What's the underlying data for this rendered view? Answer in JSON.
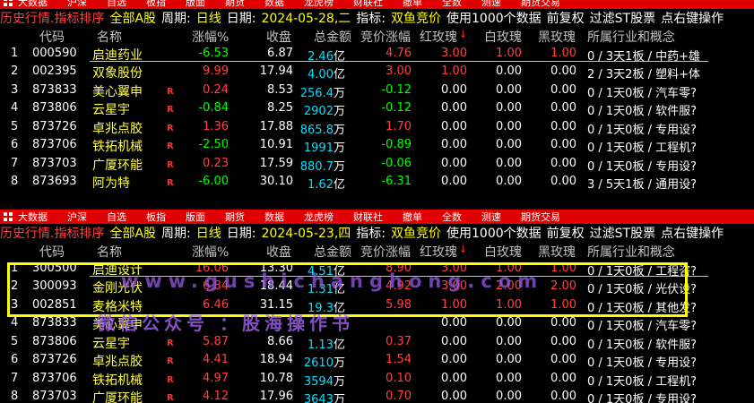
{
  "menu": [
    "大数据",
    "沪深",
    "自选",
    "板指",
    "版面",
    "期货",
    "数据",
    "龙虎榜",
    "财联社",
    "撤单",
    "全数",
    "测速",
    "期货交易"
  ],
  "colors": {
    "menu_bg": "#e00000",
    "up": "#ff4040",
    "down": "#00ff00",
    "highlight": "#ffff00"
  },
  "headers": [
    "代码",
    "名称",
    "涨幅%",
    "收盘",
    "总金额",
    "竞价涨幅",
    "红玫瑰",
    "白玫瑰",
    "黑玫瑰",
    "所属行业和概念"
  ],
  "header_arrow": "↓",
  "panels": [
    {
      "info": {
        "title": "历史行情.指标排序",
        "market": "全部A股",
        "period_label": "周期:",
        "period": "日线",
        "date_label": "日期:",
        "date": "2024-05-28,二",
        "indicator_label": "指标:",
        "indicator": "双鱼竞价",
        "use_data": "使用1000个数据",
        "adjust": "前复权",
        "filter": "过滤ST股票",
        "hint": "点右键操作"
      },
      "rows": [
        {
          "idx": "1",
          "code": "000590",
          "name": "启迪药业",
          "r": "",
          "chg": "-6.53",
          "close": "6.87",
          "amt": "2.46",
          "unit": "亿",
          "bid": "4.76",
          "red": "3.00",
          "white": "1.00",
          "black": "1.00",
          "ind": "0 / 3天1板 / 中药+雄"
        },
        {
          "idx": "2",
          "code": "002395",
          "name": "双象股份",
          "r": "",
          "chg": "9.99",
          "close": "17.94",
          "amt": "4.00",
          "unit": "亿",
          "bid": "3.00",
          "red": "1.00",
          "white": "0.00",
          "black": "0.00",
          "ind": "2 / 3天2板 / 塑料+体"
        },
        {
          "idx": "3",
          "code": "873833",
          "name": "美心翼申",
          "r": "R",
          "chg": "0.24",
          "close": "8.53",
          "amt": "256.4",
          "unit": "万",
          "bid": "-0.12",
          "red": "0.00",
          "white": "0.00",
          "black": "0.00",
          "ind": "0 / 1天0板 / 汽车零?"
        },
        {
          "idx": "4",
          "code": "873806",
          "name": "云星宇",
          "r": "R",
          "chg": "-0.84",
          "close": "8.25",
          "amt": "2902",
          "unit": "万",
          "bid": "-0.12",
          "red": "0.00",
          "white": "0.00",
          "black": "0.00",
          "ind": "0 / 1天0板 / 软件服?"
        },
        {
          "idx": "5",
          "code": "873726",
          "name": "卓兆点胶",
          "r": "R",
          "chg": "1.36",
          "close": "17.88",
          "amt": "865.8",
          "unit": "万",
          "bid": "1.70",
          "red": "0.00",
          "white": "0.00",
          "black": "0.00",
          "ind": "0 / 1天0板 / 专用设?"
        },
        {
          "idx": "6",
          "code": "873706",
          "name": "铁拓机械",
          "r": "R",
          "chg": "-2.50",
          "close": "10.91",
          "amt": "1991",
          "unit": "万",
          "bid": "-0.89",
          "red": "0.00",
          "white": "0.00",
          "black": "0.00",
          "ind": "0 / 1天0板 / 工程机?"
        },
        {
          "idx": "7",
          "code": "873703",
          "name": "广厦环能",
          "r": "R",
          "chg": "0.23",
          "close": "17.59",
          "amt": "880.7",
          "unit": "万",
          "bid": "-0.06",
          "red": "0.00",
          "white": "0.00",
          "black": "0.00",
          "ind": "0 / 1天0板 / 专用设?"
        },
        {
          "idx": "8",
          "code": "873693",
          "name": "阿为特",
          "r": "R",
          "chg": "-6.00",
          "close": "30.10",
          "amt": "1.62",
          "unit": "亿",
          "bid": "-6.31",
          "red": "0.00",
          "white": "0.00",
          "black": "0.00",
          "ind": "3 / 5天1板 / 通用设?"
        }
      ]
    },
    {
      "info": {
        "title": "历史行情.指标排序",
        "market": "全部A股",
        "period_label": "周期:",
        "period": "日线",
        "date_label": "日期:",
        "date": "2024-05-23,四",
        "indicator_label": "指标:",
        "indicator": "双鱼竞价",
        "use_data": "使用1000个数据",
        "adjust": "前复权",
        "filter": "过滤ST股票",
        "hint": "点右键操作"
      },
      "rows": [
        {
          "idx": "1",
          "code": "300500",
          "name": "启迪设计",
          "r": "",
          "chg": "16.06",
          "close": "13.30",
          "amt": "4.51",
          "unit": "亿",
          "bid": "8.90",
          "red": "3.00",
          "white": "1.00",
          "black": "1.00",
          "ind": "0 / 1天0板 / 工程咨?"
        },
        {
          "idx": "2",
          "code": "300093",
          "name": "金刚光伏",
          "r": "",
          "chg": "6.84",
          "close": "18.44",
          "amt": "1.31",
          "unit": "亿",
          "bid": "4.92",
          "red": "3.00",
          "white": "2.00",
          "black": "2.00",
          "ind": "0 / 1天0板 / 光伏设?"
        },
        {
          "idx": "3",
          "code": "002851",
          "name": "麦格米特",
          "r": "",
          "chg": "6.46",
          "close": "31.15",
          "amt": "19.3",
          "unit": "亿",
          "bid": "5.98",
          "red": "1.00",
          "white": "1.00",
          "black": "1.00",
          "ind": "0 / 1天0板 / 其他发?"
        },
        {
          "idx": "4",
          "code": "873833",
          "name": "美心翼申",
          "r": "",
          "chg": "",
          "close": "",
          "amt": "",
          "unit": "",
          "bid": "",
          "red": "0.00",
          "white": "0.00",
          "black": "0.00",
          "ind": "0 / 1天0板 / 汽车零?"
        },
        {
          "idx": "5",
          "code": "873806",
          "name": "云星宇",
          "r": "R",
          "chg": "5.87",
          "close": "8.66",
          "amt": "1.13",
          "unit": "亿",
          "bid": "0.37",
          "red": "0.00",
          "white": "0.00",
          "black": "0.00",
          "ind": "0 / 1天0板 / 软件服?"
        },
        {
          "idx": "6",
          "code": "873726",
          "name": "卓兆点胶",
          "r": "R",
          "chg": "4.41",
          "close": "18.94",
          "amt": "2610",
          "unit": "万",
          "bid": "1.54",
          "red": "0.00",
          "white": "0.00",
          "black": "0.00",
          "ind": "0 / 1天0板 / 专用设?"
        },
        {
          "idx": "7",
          "code": "873706",
          "name": "铁拓机械",
          "r": "R",
          "chg": "4.97",
          "close": "10.78",
          "amt": "3594",
          "unit": "万",
          "bid": "0.10",
          "red": "0.00",
          "white": "0.00",
          "black": "0.00",
          "ind": "0 / 1天0板 / 工程机?"
        },
        {
          "idx": "8",
          "code": "873703",
          "name": "广厦环能",
          "r": "R",
          "chg": "4.12",
          "close": "17.96",
          "amt": "3643",
          "unit": "万",
          "bid": "0.70",
          "red": "0.00",
          "white": "0.00",
          "black": "0.00",
          "ind": "0 / 1天0板 / 专用设?"
        }
      ]
    }
  ],
  "watermark": {
    "url": "www.gushichanghong.com",
    "text": "微信公众号 ：股海操作书"
  }
}
